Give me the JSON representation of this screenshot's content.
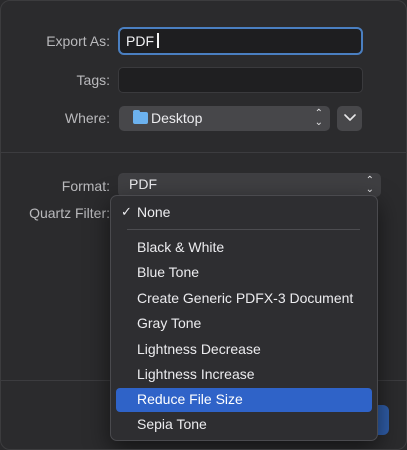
{
  "export_as": {
    "label": "Export As:",
    "value": "PDF"
  },
  "tags": {
    "label": "Tags:",
    "value": ""
  },
  "where": {
    "label": "Where:",
    "value": "Desktop"
  },
  "format": {
    "label": "Format:",
    "value": "PDF"
  },
  "quartz_filter": {
    "label": "Quartz Filter:",
    "menu": {
      "checked_item": "None",
      "items": [
        "Black & White",
        "Blue Tone",
        "Create Generic PDFX-3 Document",
        "Gray Tone",
        "Lightness Decrease",
        "Lightness Increase",
        "Reduce File Size",
        "Sepia Tone"
      ],
      "highlighted": "Reduce File Size"
    }
  },
  "icons": {
    "checkmark": "checkmark-icon",
    "folder": "folder-icon",
    "updown": "updown-chevron-icon",
    "expand": "chevron-down-icon"
  },
  "colors": {
    "accent": "#2f63c8",
    "focus_ring": "#4a7fc1",
    "folder": "#6cb2ef"
  }
}
